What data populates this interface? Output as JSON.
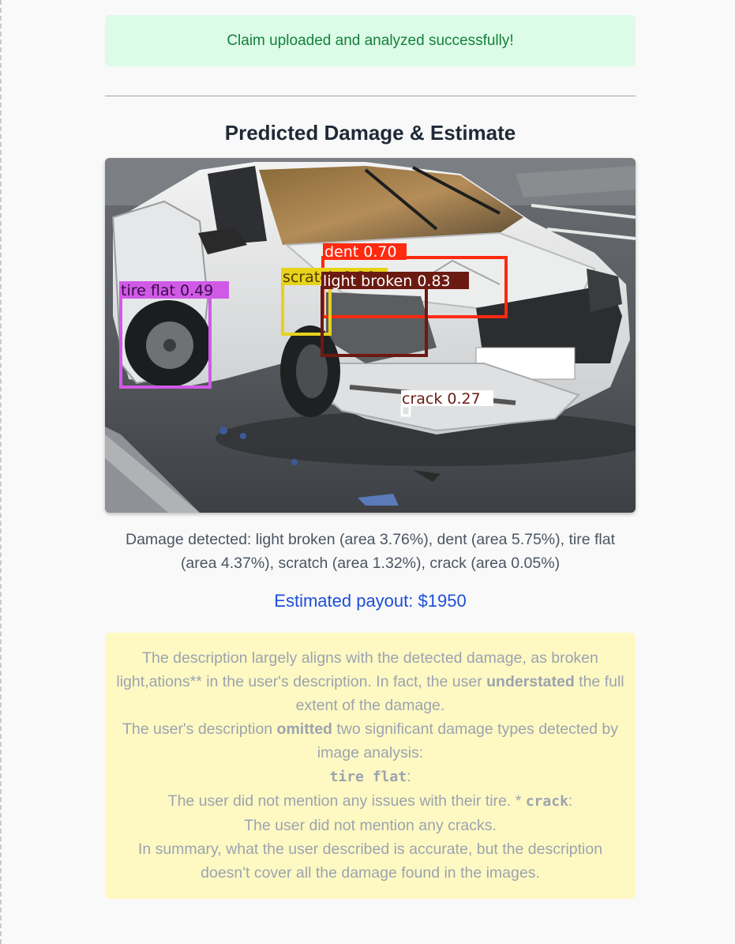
{
  "status": {
    "message": "Claim uploaded and analyzed successfully!"
  },
  "section": {
    "title": "Predicted Damage & Estimate"
  },
  "detections": {
    "dent": "dent 0.70",
    "scratch": "scratch 0.30",
    "light_broken": "light broken 0.83",
    "tire_flat": "tire flat 0.49",
    "crack": "crack 0.27"
  },
  "colors": {
    "dent": "#ff2a10",
    "scratch": "#e8d21a",
    "light_broken": "#6b1a12",
    "tire_flat": "#d05ae6",
    "crack": "#ffffff"
  },
  "damage_summary": "Damage detected: light broken (area 3.76%), dent (area 5.75%), tire flat (area 4.37%), scratch (area 1.32%), crack (area 0.05%)",
  "payout": {
    "label": "Estimated payout:",
    "amount": "$1950"
  },
  "analysis": {
    "p1_a": "The description largely aligns with the detected damage, as broken light,ations** in the user's description. In fact, the user ",
    "p1_bold": "understated",
    "p1_b": " the full extent of the damage.",
    "p2_a": "The user's description ",
    "p2_bold": "omitted",
    "p2_b": " two significant damage types detected by image analysis:",
    "item1_code": "tire flat",
    "item1_colon": ":",
    "item1_text": "The user did not mention any issues with their tire. * ",
    "item2_code": "crack",
    "item2_colon": ":",
    "item2_text": "The user did not mention any cracks.",
    "summary": "In summary, what the user described is accurate, but the description doesn't cover all the damage found in the images."
  }
}
